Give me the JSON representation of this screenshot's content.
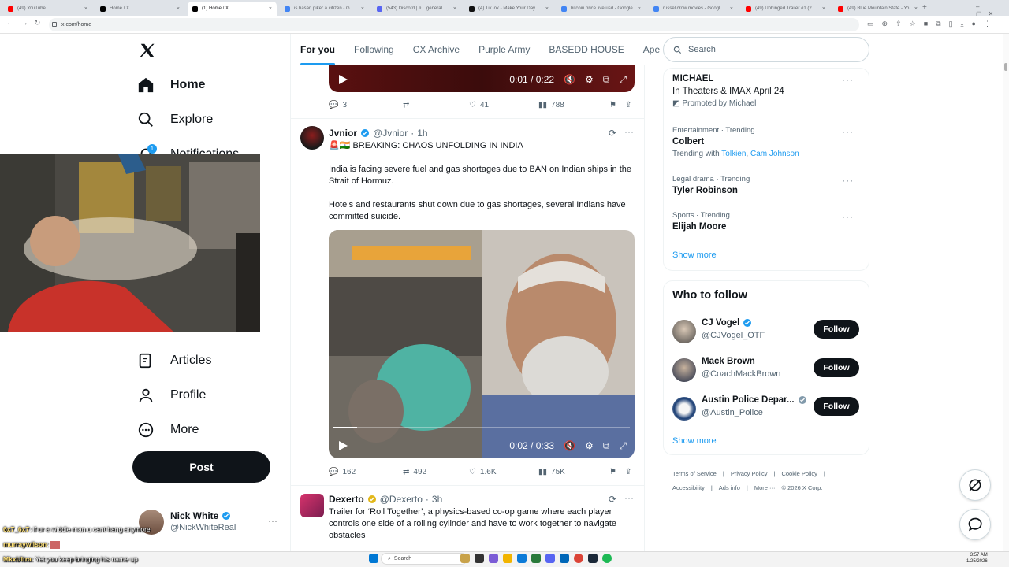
{
  "browser": {
    "tabs": [
      {
        "title": "(49) YouTube",
        "color": "#ff0000"
      },
      {
        "title": "Home / X",
        "color": "#000000"
      },
      {
        "title": "(1) Home / X",
        "color": "#000000"
      },
      {
        "title": "is hasan piker a citizen - Googl",
        "color": "#4285f4"
      },
      {
        "title": "(543) Discord | #... general",
        "color": "#5865f2"
      },
      {
        "title": "(4) TikTok - Make Your Day",
        "color": "#111111"
      },
      {
        "title": "bitcoin price live usd - Google",
        "color": "#4285f4"
      },
      {
        "title": "russel crow movies - Google S",
        "color": "#4285f4"
      },
      {
        "title": "(49) Unhinged Trailer #1 (2020",
        "color": "#ff0000"
      },
      {
        "title": "(49) Blue Mountain State - Yo",
        "color": "#ff0000"
      }
    ],
    "new_tab": "+",
    "address": "x.com/home"
  },
  "nav": {
    "home": "Home",
    "explore": "Explore",
    "notifications": "Notifications",
    "notif_badge": "1",
    "articles": "Articles",
    "profile": "Profile",
    "more": "More",
    "post": "Post"
  },
  "account": {
    "name": "Nick White",
    "handle": "@NickWhiteReal"
  },
  "feed_tabs": [
    "For you",
    "Following",
    "CX Archive",
    "Purple Army",
    "BASEDD HOUSE",
    "Ape"
  ],
  "video_top": {
    "time": "0:01 / 0:22"
  },
  "post1_actions": {
    "replies": "3",
    "reposts": "",
    "likes": "41",
    "views": "788"
  },
  "post2": {
    "name": "Jvnior",
    "handle": "@Jvnior",
    "time": "1h",
    "headline": "🚨🇮🇳 BREAKING: CHAOS UNFOLDING IN INDIA",
    "p1": "India is facing severe fuel and gas shortages due to BAN on Indian ships in the Strait of Hormuz.",
    "p2": "Hotels and restaurants shut down due to gas shortages, several Indians have committed suicide.",
    "video_time": "0:02 / 0:33",
    "replies": "162",
    "reposts": "492",
    "likes": "1.6K",
    "views": "75K"
  },
  "post3": {
    "name": "Dexerto",
    "handle": "@Dexerto",
    "time": "3h",
    "text": "Trailer for ‘Roll Together’, a physics-based co-op game where each player controls one side of a rolling cylinder and have to work together to navigate obstacles"
  },
  "search": {
    "placeholder": "Search"
  },
  "promo": {
    "title": "MICHAEL",
    "sub": "In Theaters & IMAX April 24",
    "promoted": "Promoted by Michael"
  },
  "trends": [
    {
      "meta": "Entertainment · Trending",
      "name": "Colbert",
      "sub_prefix": "Trending with",
      "links": [
        "Tolkien",
        "Cam Johnson"
      ]
    },
    {
      "meta": "Legal drama · Trending",
      "name": "Tyler Robinson"
    },
    {
      "meta": "Sports · Trending",
      "name": "Elijah Moore"
    }
  ],
  "trends_showmore": "Show more",
  "who_to_follow": {
    "title": "Who to follow",
    "items": [
      {
        "name": "CJ Vogel",
        "handle": "@CJVogel_OTF",
        "button": "Follow"
      },
      {
        "name": "Mack Brown",
        "handle": "@CoachMackBrown",
        "button": "Follow"
      },
      {
        "name": "Austin Police Depar...",
        "handle": "@Austin_Police",
        "button": "Follow"
      }
    ],
    "showmore": "Show more"
  },
  "footer": {
    "row1": [
      "Terms of Service",
      "|",
      "Privacy Policy",
      "|",
      "Cookie Policy",
      "|"
    ],
    "row2": [
      "Accessibility",
      "|",
      "Ads info",
      "|",
      "More ···",
      "© 2026 X Corp."
    ]
  },
  "chat": [
    {
      "user": "6x7_6x7",
      "msg": ": if ur a widdle man u cant hang anymore"
    },
    {
      "user": "murraywilson",
      "msg": ":"
    },
    {
      "user": "MkxUltra",
      "msg": ": Yet you keep bringing his name up"
    }
  ],
  "taskbar": {
    "search": "Search",
    "time": "3:57 AM",
    "date": "1/25/2026"
  }
}
